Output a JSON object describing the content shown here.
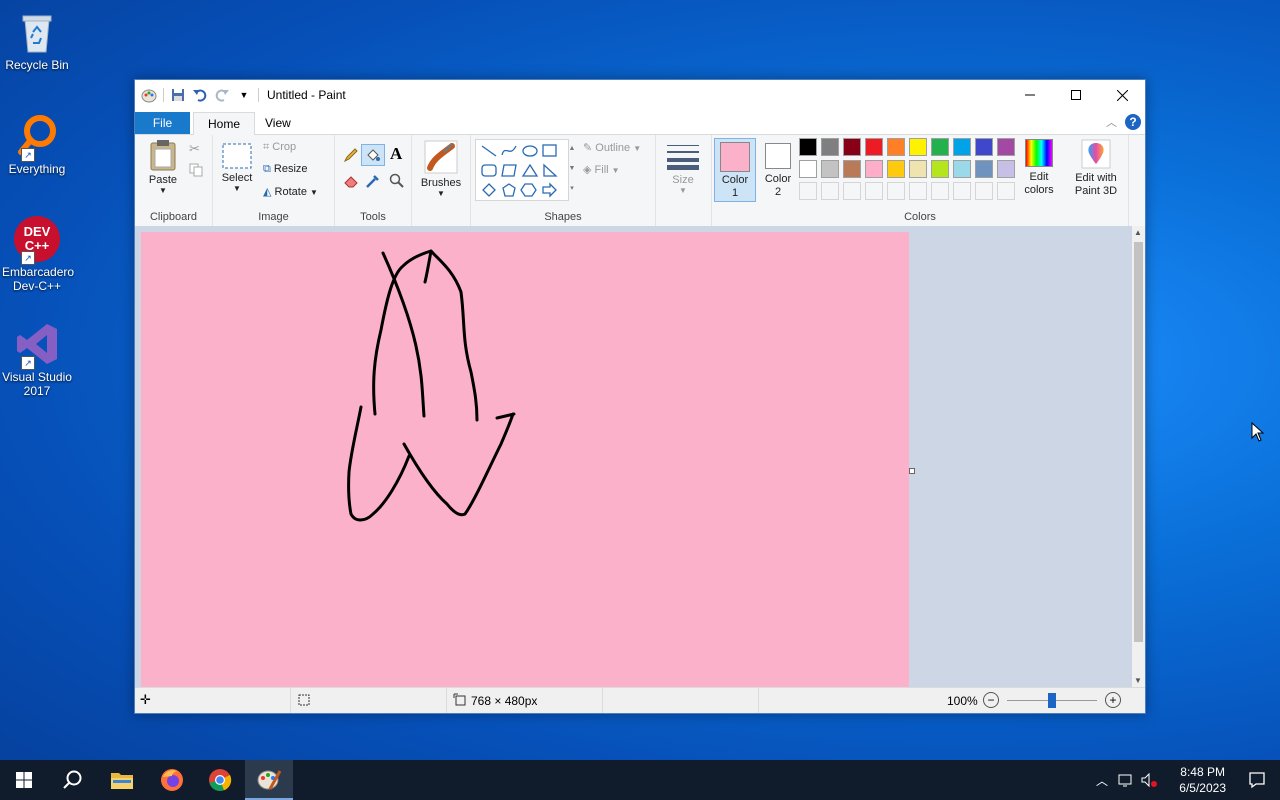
{
  "desktop": {
    "icons": [
      {
        "label": "Recycle Bin"
      },
      {
        "label": "Everything"
      },
      {
        "label": "Embarcadero Dev-C++",
        "logo": "DEV C++"
      },
      {
        "label": "Visual Studio 2017"
      }
    ]
  },
  "window": {
    "title": "Untitled - Paint",
    "tabs": [
      "File",
      "Home",
      "View"
    ]
  },
  "ribbon": {
    "clipboard": {
      "paste": "Paste",
      "label": "Clipboard"
    },
    "image": {
      "select": "Select",
      "crop": "Crop",
      "resize": "Resize",
      "rotate": "Rotate",
      "label": "Image"
    },
    "tools": {
      "label": "Tools",
      "text_tool": "A"
    },
    "brushes": {
      "label": "Brushes"
    },
    "shapes": {
      "outline": "Outline",
      "fill": "Fill",
      "label": "Shapes"
    },
    "size": {
      "label": "Size"
    },
    "colors": {
      "color1_label": "Color 1",
      "color2_label": "Color 2",
      "color1": "#fbb1ca",
      "color2": "#ffffff",
      "edit_colors": "Edit colors",
      "label": "Colors",
      "palette_row1": [
        "#000000",
        "#7f7f7f",
        "#880015",
        "#ed1c24",
        "#ff7f27",
        "#fff200",
        "#22b14c",
        "#00a2e8",
        "#3f48cc",
        "#a349a4"
      ],
      "palette_row2": [
        "#ffffff",
        "#c3c3c3",
        "#b97a57",
        "#ffaec9",
        "#ffc90e",
        "#efe4b0",
        "#b5e61d",
        "#99d9ea",
        "#7092be",
        "#c8bfe7"
      ]
    },
    "paint3d": "Edit with Paint 3D"
  },
  "canvas": {
    "background": "#fbb1ca"
  },
  "status": {
    "size": "768 × 480px",
    "zoom": "100%",
    "zoom_level": 0.5
  },
  "taskbar": {
    "time": "8:48 PM",
    "date": "6/5/2023"
  }
}
